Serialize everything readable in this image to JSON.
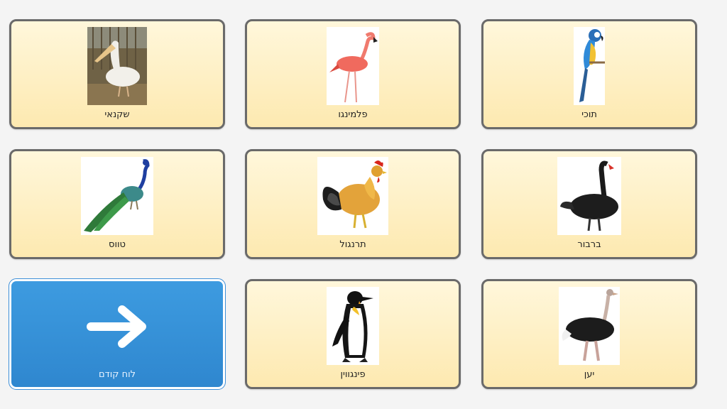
{
  "tiles": {
    "pelican": {
      "label": "שקנאי",
      "icon": "pelican-icon"
    },
    "flamingo": {
      "label": "פלמינגו",
      "icon": "flamingo-icon"
    },
    "parrot": {
      "label": "תוכי",
      "icon": "parrot-icon"
    },
    "peacock": {
      "label": "טווס",
      "icon": "peacock-icon"
    },
    "rooster": {
      "label": "תרנגול",
      "icon": "rooster-icon"
    },
    "swan": {
      "label": "ברבור",
      "icon": "black-swan-icon"
    },
    "back": {
      "label": "לוח קודם",
      "icon": "arrow-right-icon"
    },
    "penguin": {
      "label": "פינגווין",
      "icon": "penguin-icon"
    },
    "ostrich": {
      "label": "יען",
      "icon": "ostrich-icon"
    }
  },
  "colors": {
    "tile_bg": "#fdeebf",
    "tile_border": "#6a6a6a",
    "nav_bg": "#3a95dc"
  }
}
